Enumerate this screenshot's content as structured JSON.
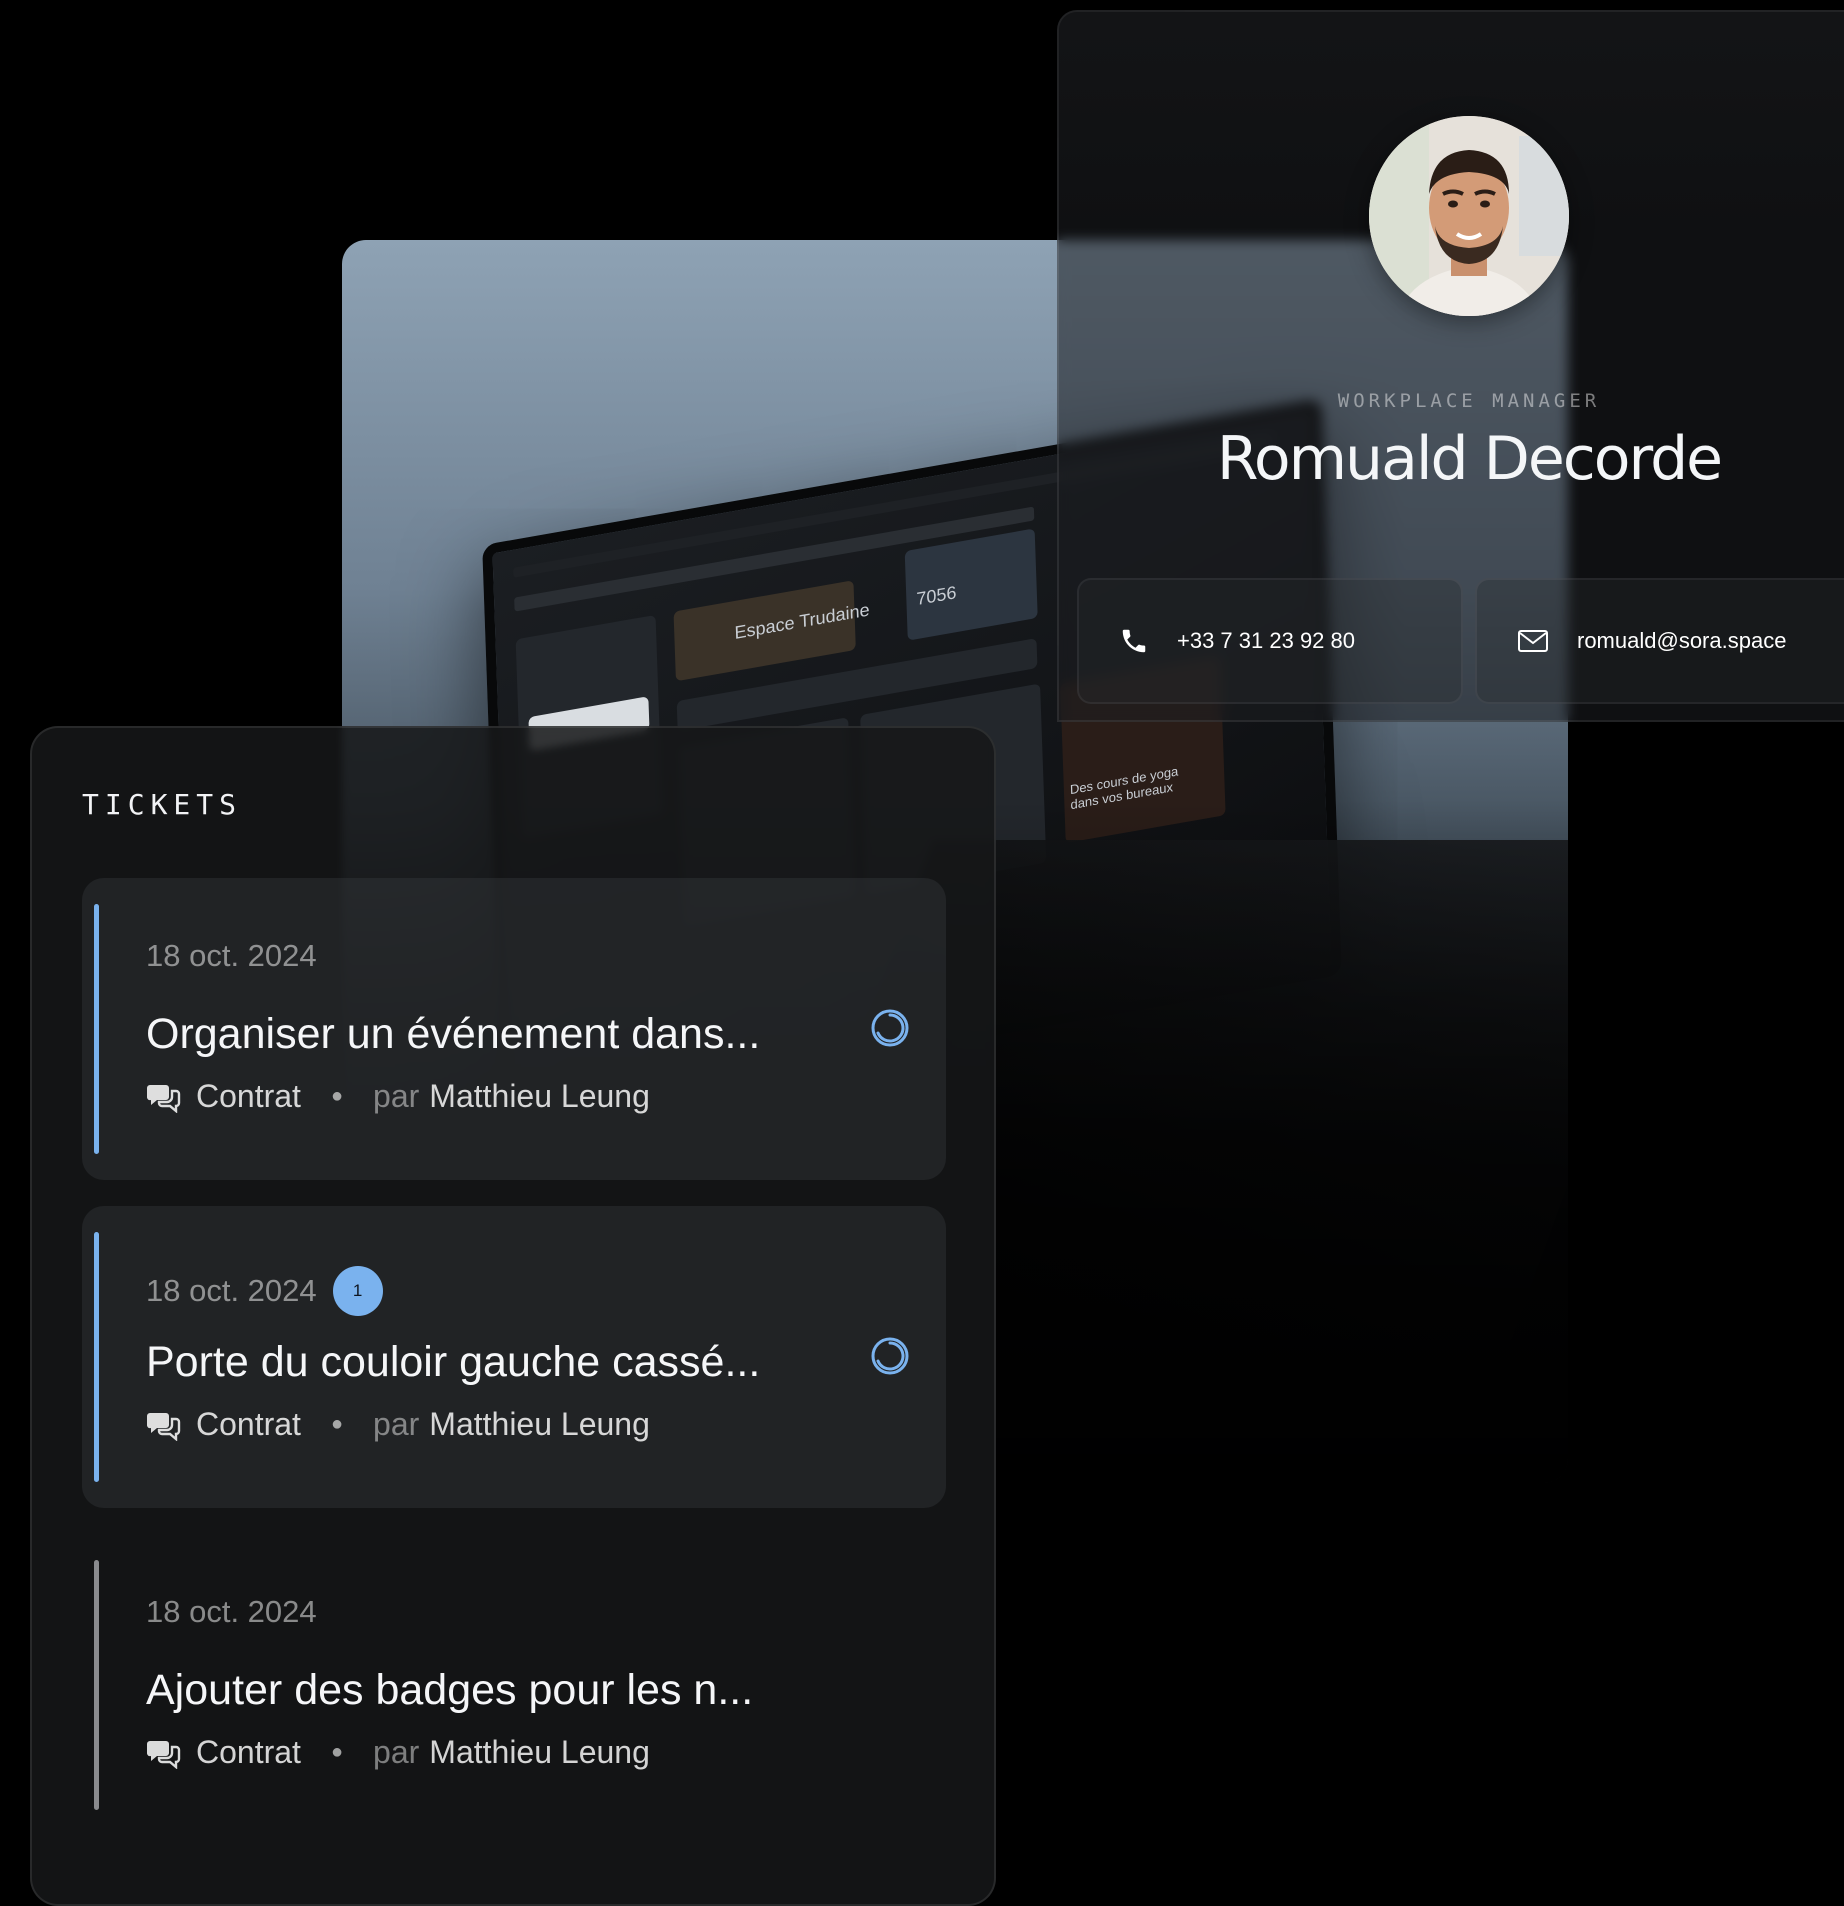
{
  "profile": {
    "role": "WORKPLACE MANAGER",
    "name": "Romuald Decorde",
    "phone": "+33 7 31 23 92 80",
    "email": "romuald@sora.space"
  },
  "photo_screen": {
    "label_space": "Espace Trudaine",
    "label_value": "7056",
    "label_promo": "Des cours de yoga dans vos bureaux"
  },
  "tickets": {
    "title": "TICKETS",
    "items": [
      {
        "date": "18 oct. 2024",
        "title": "Organiser un événement dans...",
        "category": "Contrat",
        "by_prefix": "par",
        "author": "Matthieu Leung",
        "count": ""
      },
      {
        "date": "18 oct. 2024",
        "title": "Porte du couloir gauche cassé...",
        "category": "Contrat",
        "by_prefix": "par",
        "author": "Matthieu Leung",
        "count": "1"
      },
      {
        "date": "18 oct. 2024",
        "title": "Ajouter des badges pour les n...",
        "category": "Contrat",
        "by_prefix": "par",
        "author": "Matthieu Leung",
        "count": ""
      }
    ]
  },
  "colors": {
    "accent": "#7ab2ee",
    "background": "#000000",
    "card": "#161719"
  },
  "icons": {
    "phone": "phone-icon",
    "mail": "mail-icon",
    "comment": "comment-icon",
    "status": "in-progress-icon"
  }
}
